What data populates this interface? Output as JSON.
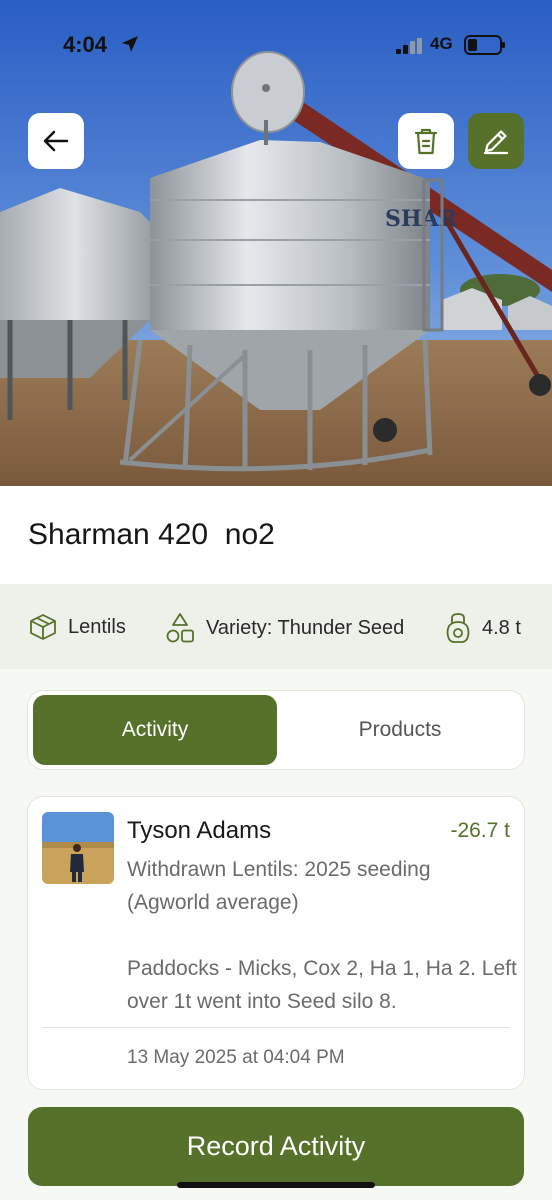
{
  "status_bar": {
    "time": "4:04",
    "network": "4G"
  },
  "silo": {
    "title": "Sharman 420  no2",
    "photo_brand": "SHAR"
  },
  "attributes": {
    "crop": "Lentils",
    "variety": "Variety: Thunder Seed",
    "weight": "4.8 t"
  },
  "tabs": {
    "activity": "Activity",
    "products": "Products",
    "selected": "Activity"
  },
  "activity": {
    "user": "Tyson Adams",
    "amount": "-26.7 t",
    "description": "Withdrawn Lentils: 2025 seeding (Agworld average)\n\nPaddocks - Micks, Cox 2, Ha 1, Ha 2. Left over 1t went into Seed silo 8.",
    "timestamp": "13 May 2025 at 04:04 PM"
  },
  "actions": {
    "record": "Record Activity"
  },
  "colors": {
    "accent": "#56722a",
    "amount": "#56722a",
    "background": "#f6f8f4"
  },
  "icons": {
    "back": "arrow-left-icon",
    "delete": "trash-icon",
    "edit": "pencil-icon",
    "crop": "box-icon",
    "variety": "shapes-icon",
    "weight": "kettlebell-icon"
  }
}
